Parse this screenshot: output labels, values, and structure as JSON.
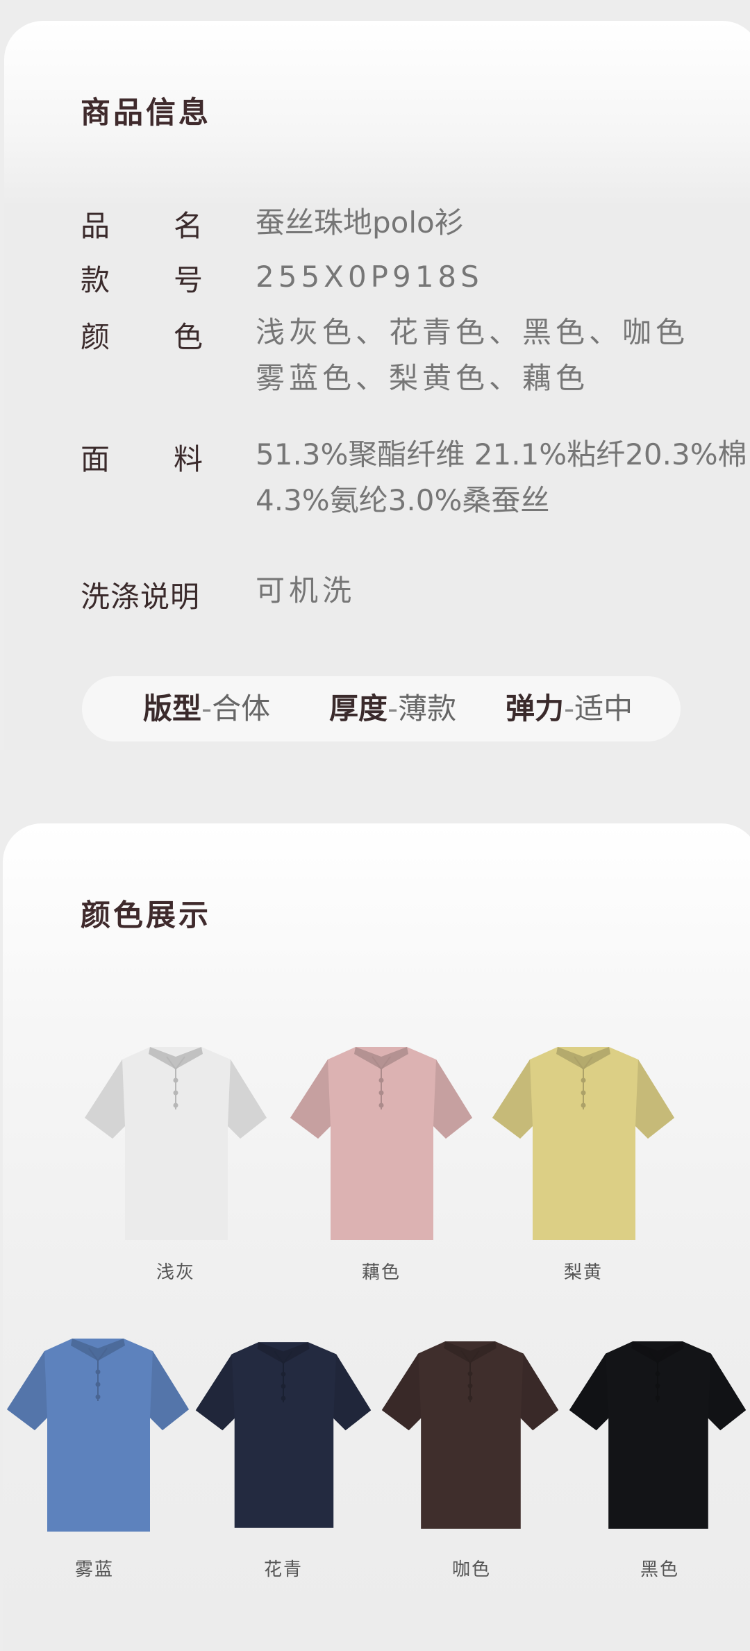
{
  "info_section": {
    "title": "商品信息",
    "rows": [
      {
        "label": "品名",
        "value_lines": [
          "蚕丝珠地polo衫"
        ]
      },
      {
        "label": "款号",
        "value_lines": [
          "255X0P918S"
        ]
      },
      {
        "label": "颜色",
        "value_lines": [
          "浅灰色、花青色、黑色、咖色",
          "雾蓝色、梨黄色、藕色"
        ]
      },
      {
        "label": "面料",
        "value_lines": [
          "51.3%聚酯纤维 21.1%粘纤20.3%棉",
          "4.3%氨纶3.0%桑蚕丝"
        ]
      },
      {
        "label": "洗涤说明",
        "value_lines": [
          "可机洗"
        ]
      }
    ],
    "attributes": [
      {
        "key": "版型",
        "sep": "-",
        "value": "合体"
      },
      {
        "key": "厚度",
        "sep": "-",
        "value": "薄款"
      },
      {
        "key": "弹力",
        "sep": "-",
        "value": "适中"
      }
    ]
  },
  "color_section": {
    "title": "颜色展示",
    "swatches": [
      {
        "name": "浅灰",
        "color": "#ebebeb",
        "icon": "polo-shirt-icon"
      },
      {
        "name": "藕色",
        "color": "#dcb2b2",
        "icon": "polo-shirt-icon"
      },
      {
        "name": "梨黄",
        "color": "#dccf85",
        "icon": "polo-shirt-icon"
      },
      {
        "name": "雾蓝",
        "color": "#5d82bd",
        "icon": "polo-shirt-icon"
      },
      {
        "name": "花青",
        "color": "#232a40",
        "icon": "polo-shirt-icon"
      },
      {
        "name": "咖色",
        "color": "#3f2e2c",
        "icon": "polo-shirt-icon"
      },
      {
        "name": "黑色",
        "color": "#131417",
        "icon": "polo-shirt-icon"
      }
    ]
  }
}
